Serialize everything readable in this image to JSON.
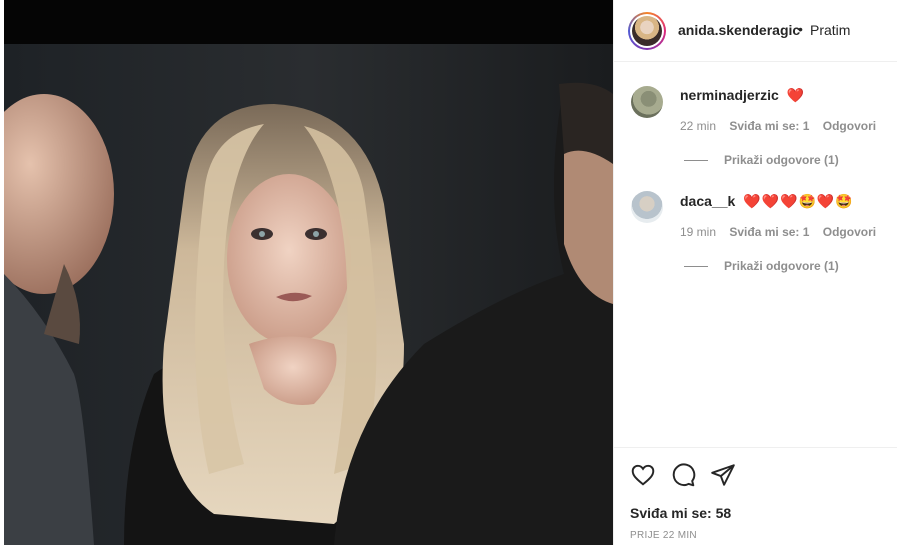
{
  "post": {
    "username": "anida.skenderagic",
    "separator": "•",
    "follow_label": "Pratim"
  },
  "comments": [
    {
      "username": "nerminadjerzic",
      "text": "❤️",
      "time": "22 min",
      "likes": "Sviđa mi se: 1",
      "reply_label": "Odgovori",
      "view_replies": "Prikaži odgovore (1)"
    },
    {
      "username": "daca__k",
      "text": "❤️❤️❤️🤩❤️🤩",
      "time": "19 min",
      "likes": "Sviđa mi se: 1",
      "reply_label": "Odgovori",
      "view_replies": "Prikaži odgovore (1)"
    }
  ],
  "actions": {
    "icons": [
      "heart-icon",
      "comment-icon",
      "share-icon"
    ],
    "likes_text": "Sviđa mi se: 58",
    "timestamp": "PRIJE 22 MIN"
  }
}
